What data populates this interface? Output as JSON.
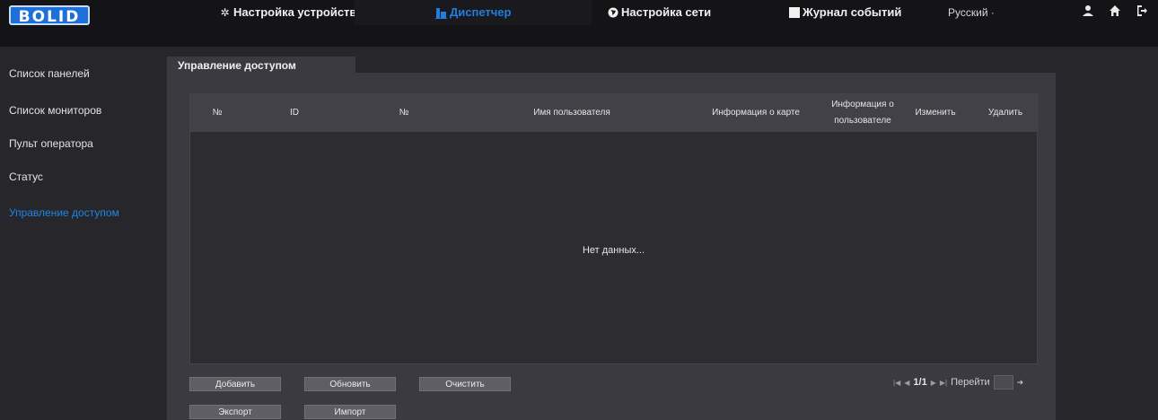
{
  "brand": {
    "logo": "BOLID"
  },
  "nav": {
    "device_settings": "Настройка устройства",
    "dispatcher": "Диспетчер",
    "network_settings": "Настройка сети",
    "event_log": "Журнал событий",
    "language": "Русский ·"
  },
  "sidebar": {
    "items": [
      {
        "label": "Список панелей"
      },
      {
        "label": "Список мониторов"
      },
      {
        "label": "Пульт оператора"
      },
      {
        "label": "Статус"
      },
      {
        "label": "Управление доступом"
      }
    ]
  },
  "main": {
    "tab": "Управление доступом",
    "table": {
      "columns": [
        "№",
        "ID",
        "№",
        "Имя пользователя",
        "Информация о карте",
        "Информация о пользователе",
        "Изменить",
        "Удалить"
      ],
      "empty_text": "Нет данных..."
    },
    "buttons": {
      "add": "Добавить",
      "refresh": "Обновить",
      "clear": "Очистить",
      "export": "Экспорт",
      "import": "Импорт"
    },
    "pager": {
      "page": "1/1",
      "goto_label": "Перейти"
    }
  },
  "colors": {
    "accent": "#1f86e8",
    "topbar": "#141417",
    "panel": "#3a3a40"
  }
}
